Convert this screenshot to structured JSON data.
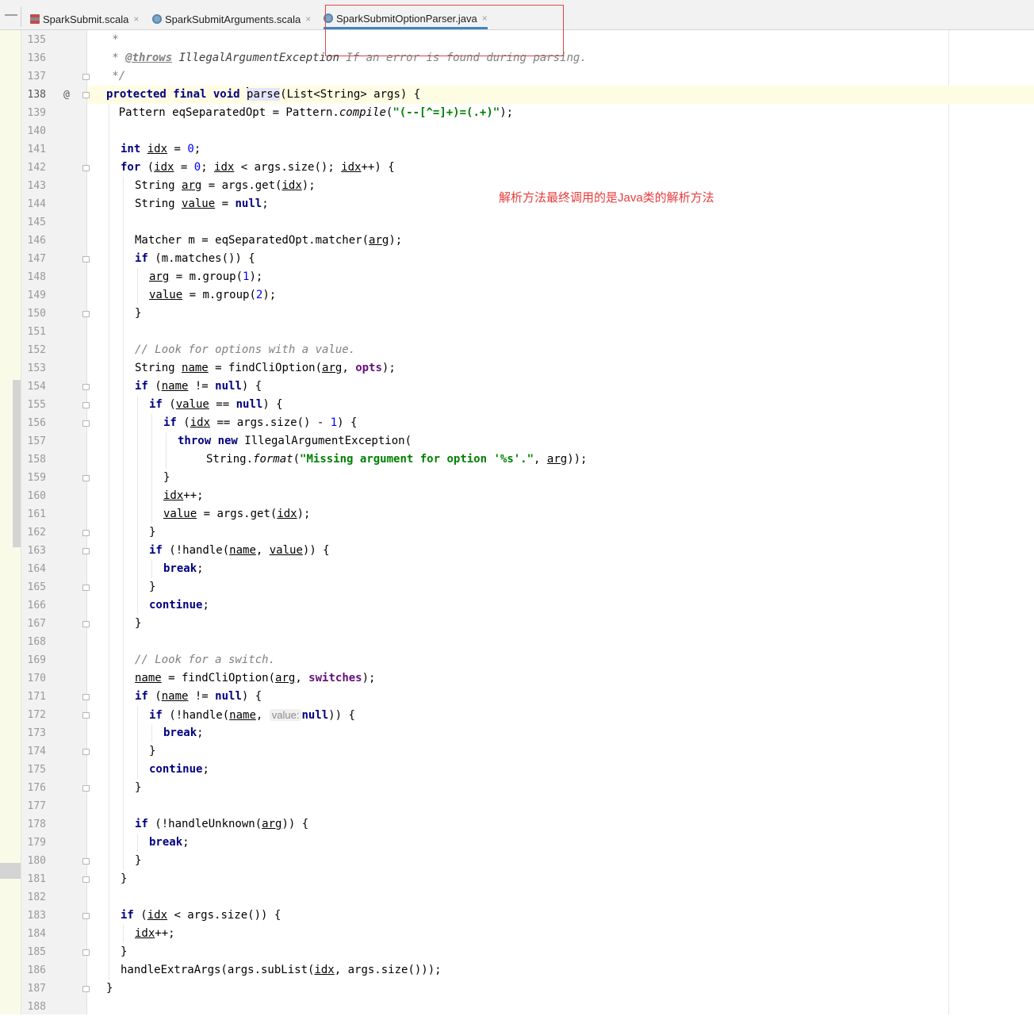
{
  "tabs": [
    {
      "label": "SparkSubmit.scala",
      "close": "×",
      "icon": "scala-file-icon",
      "active": false
    },
    {
      "label": "SparkSubmitArguments.scala",
      "close": "×",
      "icon": "scala-class-icon",
      "active": false
    },
    {
      "label": "SparkSubmitOptionParser.java",
      "close": "×",
      "icon": "java-class-icon",
      "active": true
    }
  ],
  "tabbar": {
    "collapse": "—"
  },
  "annotation": "解析方法最终调用的是Java类的解析方法",
  "gutter": {
    "override_marker": "@",
    "current_line": 138
  },
  "lines": [
    135,
    136,
    137,
    138,
    139,
    140,
    141,
    142,
    143,
    144,
    145,
    146,
    147,
    148,
    149,
    150,
    151,
    152,
    153,
    154,
    155,
    156,
    157,
    158,
    159,
    160,
    161,
    162,
    163,
    164,
    165,
    166,
    167,
    168,
    169,
    170,
    171,
    172,
    173,
    174,
    175,
    176,
    177,
    178,
    179,
    180,
    181,
    182,
    183,
    184,
    185,
    186,
    187,
    188
  ],
  "code": {
    "l135": {
      "a": "   *"
    },
    "l136": {
      "a": "   * ",
      "b": "@throws",
      "c": " IllegalArgumentException",
      "d": " If an error is found during parsing."
    },
    "l137": {
      "a": "   */"
    },
    "l138": {
      "kw": "protected final void ",
      "fn": "parse",
      "rest": "(List<String> args) {"
    },
    "l139": {
      "a": "    Pattern eqSeparatedOpt = Pattern.",
      "b": "compile",
      "c": "(",
      "s": "\"(--[^=]+)=(.+)\"",
      "d": ");"
    },
    "l141": {
      "kw": "int ",
      "v": "idx",
      "a": " = ",
      "n": "0",
      "b": ";"
    },
    "l142": {
      "kw": "for",
      "a": " (",
      "v1": "idx",
      "b": " = ",
      "n": "0",
      "c": "; ",
      "v2": "idx",
      "d": " < args.size(); ",
      "v3": "idx",
      "e": "++) {"
    },
    "l143": {
      "a": "String ",
      "v": "arg",
      "b": " = args.get(",
      "v2": "idx",
      "c": ");"
    },
    "l144": {
      "a": "String ",
      "v": "value",
      "b": " = ",
      "kw": "null",
      "c": ";"
    },
    "l146": {
      "a": "Matcher m = eqSeparatedOpt.matcher(",
      "v": "arg",
      "b": ");"
    },
    "l147": {
      "kw": "if",
      "a": " (m.matches()) {"
    },
    "l148": {
      "v": "arg",
      "a": " = m.group(",
      "n": "1",
      "b": ");"
    },
    "l149": {
      "v": "value",
      "a": " = m.group(",
      "n": "2",
      "b": ");"
    },
    "l150": {
      "a": "}"
    },
    "l152": {
      "cm": "// Look for options with a value."
    },
    "l153": {
      "a": "String ",
      "v": "name",
      "b": " = findCliOption(",
      "v2": "arg",
      "c": ", ",
      "f": "opts",
      "d": ");"
    },
    "l154": {
      "kw": "if",
      "a": " (",
      "v": "name",
      "b": " != ",
      "kw2": "null",
      "c": ") {"
    },
    "l155": {
      "kw": "if",
      "a": " (",
      "v": "value",
      "b": " == ",
      "kw2": "null",
      "c": ") {"
    },
    "l156": {
      "kw": "if",
      "a": " (",
      "v": "idx",
      "b": " == args.size() - ",
      "n": "1",
      "c": ") {"
    },
    "l157": {
      "kw": "throw new",
      "a": " IllegalArgumentException("
    },
    "l158": {
      "a": "String.",
      "it": "format",
      "b": "(",
      "s": "\"Missing argument for option '%s'.\"",
      "c": ", ",
      "v": "arg",
      "d": "));"
    },
    "l159": {
      "a": "}"
    },
    "l160": {
      "v": "idx",
      "a": "++;"
    },
    "l161": {
      "v": "value",
      "a": " = args.get(",
      "v2": "idx",
      "b": ");"
    },
    "l162": {
      "a": "}"
    },
    "l163": {
      "kw": "if",
      "a": " (!handle(",
      "v": "name",
      "b": ", ",
      "v2": "value",
      "c": ")) {"
    },
    "l164": {
      "kw": "break",
      "a": ";"
    },
    "l165": {
      "a": "}"
    },
    "l166": {
      "kw": "continue",
      "a": ";"
    },
    "l167": {
      "a": "}"
    },
    "l169": {
      "cm": "// Look for a switch."
    },
    "l170": {
      "v": "name",
      "a": " = findCliOption(",
      "v2": "arg",
      "b": ", ",
      "f": "switches",
      "c": ");"
    },
    "l171": {
      "kw": "if",
      "a": " (",
      "v": "name",
      "b": " != ",
      "kw2": "null",
      "c": ") {"
    },
    "l172": {
      "kw": "if",
      "a": " (!handle(",
      "v": "name",
      "b": ", ",
      "hint": "value:",
      "kw2": "null",
      "c": ")) {"
    },
    "l173": {
      "kw": "break",
      "a": ";"
    },
    "l174": {
      "a": "}"
    },
    "l175": {
      "kw": "continue",
      "a": ";"
    },
    "l176": {
      "a": "}"
    },
    "l178": {
      "kw": "if",
      "a": " (!handleUnknown(",
      "v": "arg",
      "b": ")) {"
    },
    "l179": {
      "kw": "break",
      "a": ";"
    },
    "l180": {
      "a": "}"
    },
    "l181": {
      "a": "}"
    },
    "l183": {
      "kw": "if",
      "a": " (",
      "v": "idx",
      "b": " < args.size()) {"
    },
    "l184": {
      "v": "idx",
      "a": "++;"
    },
    "l185": {
      "a": "}"
    },
    "l186": {
      "a": "handleExtraArgs(args.subList(",
      "v": "idx",
      "b": ", args.size()));"
    },
    "l187": {
      "a": "}"
    }
  }
}
